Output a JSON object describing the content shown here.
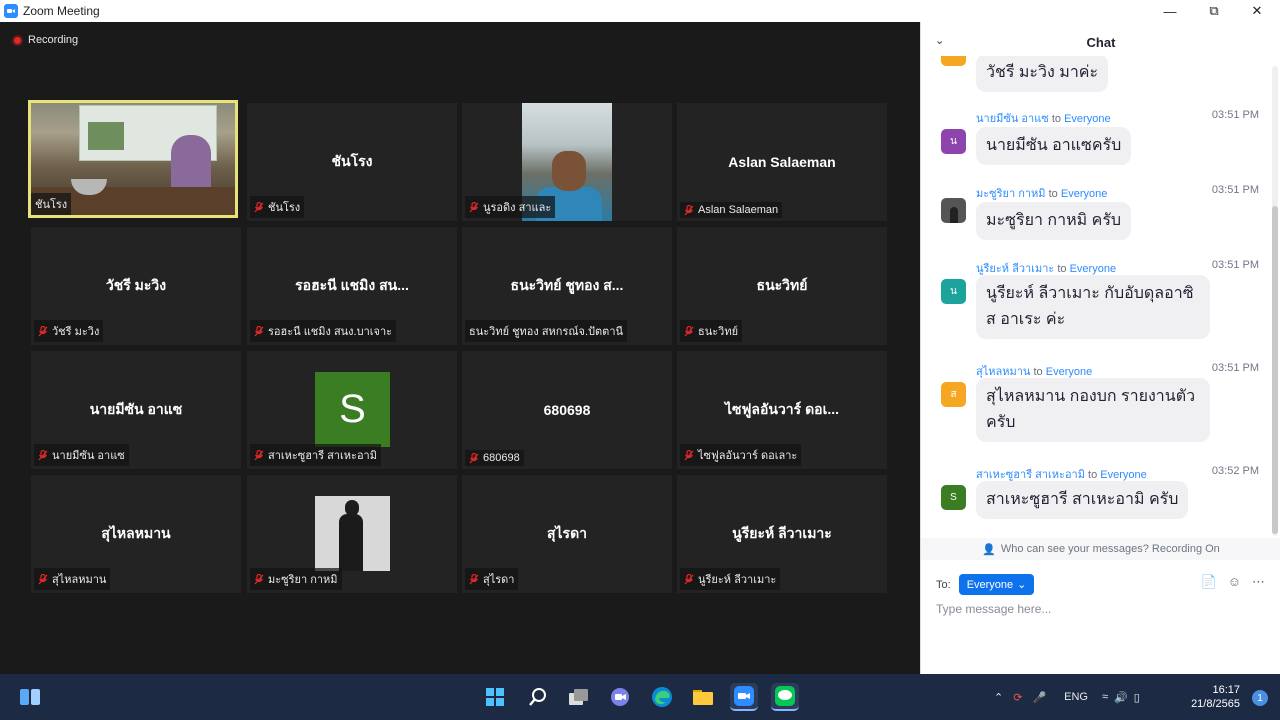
{
  "window": {
    "title": "Zoom Meeting",
    "controls": [
      "minimize",
      "maximize",
      "close"
    ]
  },
  "meeting": {
    "recording_label": "Recording",
    "tiles": [
      {
        "id": "t1",
        "center_name": "",
        "tag": "ชันโรง",
        "muted": false,
        "video": "cam1",
        "active": true
      },
      {
        "id": "t2",
        "center_name": "ชันโรง",
        "tag": "ชันโรง",
        "muted": true
      },
      {
        "id": "t3",
        "center_name": "",
        "tag": "นูรอดิง สาและ",
        "muted": true,
        "video": "cam3"
      },
      {
        "id": "t4",
        "center_name": "Aslan Salaeman",
        "tag": "Aslan Salaeman",
        "muted": true
      },
      {
        "id": "t5",
        "center_name": "วัชรี มะวิง",
        "tag": "วัชรี มะวิง",
        "muted": true
      },
      {
        "id": "t6",
        "center_name": "รอฮะนี แชมิง สน...",
        "tag": "รอฮะนี แชมิง สนง.บาเจาะ",
        "muted": true
      },
      {
        "id": "t7",
        "center_name": "ธนะวิทย์ ชูทอง ส...",
        "tag": "ธนะวิทย์ ชูทอง สหกรณ์จ.ปัตตานี",
        "muted": false
      },
      {
        "id": "t8",
        "center_name": "ธนะวิทย์",
        "tag": "ธนะวิทย์",
        "muted": true
      },
      {
        "id": "t9",
        "center_name": "นายมีซัน อาแซ",
        "tag": "นายมีซัน อาแซ",
        "muted": true
      },
      {
        "id": "t10",
        "center_name": "",
        "tag": "สาเหะซูฮารี สาเหะอามิ",
        "muted": true,
        "avatar_letter": "S"
      },
      {
        "id": "t11",
        "center_name": "680698",
        "tag": "680698",
        "muted": true
      },
      {
        "id": "t12",
        "center_name": "ไซฟูลอันวาร์ ดอเ...",
        "tag": "ไซฟูลอันวาร์ ดอเลาะ",
        "muted": true
      },
      {
        "id": "t13",
        "center_name": "สุไหลหมาน",
        "tag": "สุไหลหมาน",
        "muted": true
      },
      {
        "id": "t14",
        "center_name": "",
        "tag": "มะซูริยา กาหมิ",
        "muted": true,
        "avatar_photo": true
      },
      {
        "id": "t15",
        "center_name": "สุไรดา",
        "tag": "สุไรดา",
        "muted": true
      },
      {
        "id": "t16",
        "center_name": "นูรียะห์ ลีวาเมาะ",
        "tag": "นูรียะห์ ลีวาเมาะ",
        "muted": true
      }
    ]
  },
  "chat": {
    "title": "Chat",
    "messages": [
      {
        "sender": "",
        "to_text": "",
        "recipient": "",
        "time": "",
        "avatar_letter": "",
        "avatar_color": "#f5a623",
        "lines": [
          "วัชรี มะวิง มาค่ะ"
        ]
      },
      {
        "sender": "นายมีซัน อาแซ",
        "to_text": "to",
        "recipient": "Everyone",
        "time": "03:51 PM",
        "avatar_letter": "น",
        "avatar_color": "#8e44ad",
        "lines": [
          "นายมีซัน  อาแซครับ"
        ]
      },
      {
        "sender": "มะซูริยา กาหมิ",
        "to_text": "to",
        "recipient": "Everyone",
        "time": "03:51 PM",
        "avatar_letter": "",
        "avatar_color": "#555555",
        "lines": [
          "มะซูริยา กาหมิ ครับ"
        ]
      },
      {
        "sender": "นูรียะห์ ลีวาเมาะ",
        "to_text": "to",
        "recipient": "Everyone",
        "time": "03:51 PM",
        "avatar_letter": "น",
        "avatar_color": "#1ba39c",
        "lines": [
          "นูรียะห์ ลีวาเมาะ กับอับดุลอาซิ",
          "ส อาเระ ค่ะ"
        ]
      },
      {
        "sender": "สุไหลหมาน",
        "to_text": "to",
        "recipient": "Everyone",
        "time": "03:51 PM",
        "avatar_letter": "ส",
        "avatar_color": "#f5a623",
        "lines": [
          "สุไหลหมาน กองบก รายงานตัว",
          "ครับ"
        ]
      },
      {
        "sender": "สาเหะซูฮารี สาเหะอามิ",
        "to_text": "to",
        "recipient": "Everyone",
        "time": "03:52 PM",
        "avatar_letter": "S",
        "avatar_color": "#3b7d23",
        "lines": [
          "สาเหะซูฮารี สาเหะอามิ ครับ"
        ]
      }
    ],
    "privacy_note": "Who can see your messages? Recording On",
    "to_label": "To:",
    "recipient_button": "Everyone",
    "input_placeholder": "Type message here..."
  },
  "taskbar": {
    "apps": [
      "start",
      "search",
      "task-view",
      "teams-chat",
      "edge",
      "file-explorer",
      "zoom",
      "line"
    ],
    "tray": {
      "language": "ENG",
      "time": "16:17",
      "date": "21/8/2565",
      "notification_count": "1"
    }
  }
}
